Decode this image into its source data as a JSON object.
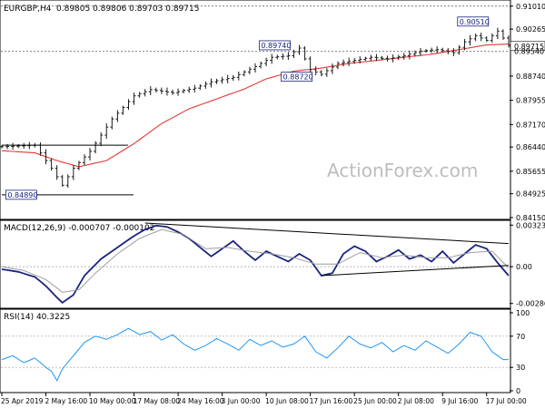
{
  "chart_data": [
    {
      "type": "candlestick",
      "panel": "price",
      "title": "EURGBP,H4",
      "ohlc_header": "0.89805 0.89806 0.89703 0.89715",
      "y_ticks": [
        "0.91010",
        "0.90265",
        "0.89715",
        "0.88740",
        "0.87955",
        "0.87170",
        "0.86440",
        "0.85655",
        "0.84925",
        "0.84150"
      ],
      "ylim": [
        0.8415,
        0.9115
      ],
      "current_price": "0.89715",
      "current_price_box_color": "#ffffff",
      "ref_line_price": "0.89540",
      "top_ref_price": "0.91010",
      "annotations": [
        {
          "label": "0.84890",
          "value": 0.8489
        },
        {
          "label": "0.89740",
          "value": 0.8974
        },
        {
          "label": "0.88720",
          "value": 0.8872
        },
        {
          "label": "0.90510",
          "value": 0.9051
        }
      ],
      "watermark": "ActionForex.com",
      "ma_color": "#e53935",
      "bar_color": "#1a1a1a",
      "close_path": [
        [
          0,
          0.8645
        ],
        [
          6,
          0.865
        ],
        [
          9,
          0.8575
        ],
        [
          11,
          0.852
        ],
        [
          13,
          0.8575
        ],
        [
          16,
          0.863
        ],
        [
          20,
          0.8735
        ],
        [
          24,
          0.881
        ],
        [
          27,
          0.883
        ],
        [
          31,
          0.882
        ],
        [
          35,
          0.8835
        ],
        [
          38,
          0.8855
        ],
        [
          42,
          0.887
        ],
        [
          46,
          0.8905
        ],
        [
          49,
          0.8935
        ],
        [
          52,
          0.894
        ],
        [
          54,
          0.8965
        ],
        [
          56,
          0.8895
        ],
        [
          58,
          0.888
        ],
        [
          61,
          0.8915
        ],
        [
          64,
          0.8925
        ],
        [
          67,
          0.8935
        ],
        [
          70,
          0.893
        ],
        [
          73,
          0.894
        ],
        [
          76,
          0.8955
        ],
        [
          79,
          0.896
        ],
        [
          82,
          0.895
        ],
        [
          84,
          0.8985
        ],
        [
          86,
          0.9005
        ],
        [
          88,
          0.899
        ],
        [
          90,
          0.902
        ],
        [
          92,
          0.8975
        ]
      ],
      "ma_path": [
        [
          0,
          0.8632
        ],
        [
          6,
          0.8625
        ],
        [
          10,
          0.86
        ],
        [
          14,
          0.858
        ],
        [
          19,
          0.86
        ],
        [
          24,
          0.8655
        ],
        [
          29,
          0.872
        ],
        [
          34,
          0.8768
        ],
        [
          39,
          0.88
        ],
        [
          44,
          0.8832
        ],
        [
          48,
          0.8865
        ],
        [
          53,
          0.889
        ],
        [
          58,
          0.89
        ],
        [
          63,
          0.8915
        ],
        [
          68,
          0.8925
        ],
        [
          73,
          0.8935
        ],
        [
          78,
          0.8945
        ],
        [
          83,
          0.896
        ],
        [
          88,
          0.8975
        ],
        [
          92,
          0.8978
        ]
      ],
      "trendlines": [
        {
          "from": [
            0,
            0.865
          ],
          "to": [
            13,
            0.865
          ]
        },
        {
          "from": [
            0,
            0.8489
          ],
          "to": [
            14,
            0.8489
          ]
        }
      ],
      "x_count": 93
    },
    {
      "type": "line",
      "panel": "macd",
      "title": "MACD(12,26,9) -0.000707 -0.000102",
      "y_ticks": [
        "0.003239",
        "0.00",
        "-0.002868"
      ],
      "ylim": [
        -0.0031,
        0.0034
      ],
      "series": [
        {
          "color": "#1a237e",
          "values": [
            [
              0,
              -0.0002
            ],
            [
              3,
              -0.0004
            ],
            [
              6,
              -0.0008
            ],
            [
              8,
              -0.0015
            ],
            [
              10,
              -0.0024
            ],
            [
              11,
              -0.0028
            ],
            [
              13,
              -0.0022
            ],
            [
              15,
              -0.0007
            ],
            [
              18,
              0.0006
            ],
            [
              21,
              0.0015
            ],
            [
              24,
              0.0024
            ],
            [
              26,
              0.0029
            ],
            [
              28,
              0.0032
            ],
            [
              30,
              0.0031
            ],
            [
              32,
              0.0027
            ],
            [
              34,
              0.0022
            ],
            [
              36,
              0.0015
            ],
            [
              38,
              0.0008
            ],
            [
              40,
              0.0014
            ],
            [
              42,
              0.002
            ],
            [
              44,
              0.0012
            ],
            [
              46,
              0.0005
            ],
            [
              48,
              0.0012
            ],
            [
              50,
              0.0008
            ],
            [
              52,
              0.0004
            ],
            [
              54,
              0.001
            ],
            [
              56,
              0.0005
            ],
            [
              58,
              -0.0007
            ],
            [
              60,
              -0.0005
            ],
            [
              62,
              0.001
            ],
            [
              64,
              0.0016
            ],
            [
              66,
              0.0012
            ],
            [
              68,
              0.0004
            ],
            [
              70,
              0.0008
            ],
            [
              72,
              0.0013
            ],
            [
              74,
              0.0006
            ],
            [
              76,
              0.0009
            ],
            [
              78,
              0.0004
            ],
            [
              80,
              0.0012
            ],
            [
              82,
              0.0003
            ],
            [
              84,
              0.001
            ],
            [
              86,
              0.0017
            ],
            [
              88,
              0.0014
            ],
            [
              90,
              0.0003
            ],
            [
              92,
              -0.0007
            ]
          ]
        },
        {
          "color": "#9e9e9e",
          "values": [
            [
              0,
              0.0
            ],
            [
              4,
              -0.0003
            ],
            [
              8,
              -0.001
            ],
            [
              11,
              -0.002
            ],
            [
              14,
              -0.0018
            ],
            [
              17,
              -0.0005
            ],
            [
              21,
              0.001
            ],
            [
              25,
              0.0022
            ],
            [
              29,
              0.0029
            ],
            [
              33,
              0.0025
            ],
            [
              37,
              0.0014
            ],
            [
              41,
              0.0015
            ],
            [
              45,
              0.0012
            ],
            [
              49,
              0.001
            ],
            [
              53,
              0.0007
            ],
            [
              57,
              0.0002
            ],
            [
              61,
              0.0002
            ],
            [
              65,
              0.0011
            ],
            [
              69,
              0.0007
            ],
            [
              73,
              0.0009
            ],
            [
              77,
              0.0007
            ],
            [
              81,
              0.0007
            ],
            [
              85,
              0.0011
            ],
            [
              89,
              0.0012
            ],
            [
              92,
              -0.0001
            ]
          ]
        }
      ],
      "trendlines": [
        {
          "from": [
            26,
            0.0034
          ],
          "to": [
            92,
            0.0018
          ]
        },
        {
          "from": [
            58,
            -0.0007
          ],
          "to": [
            92,
            0.0001
          ]
        }
      ],
      "x_count": 93
    },
    {
      "type": "line",
      "panel": "rsi",
      "title": "RSI(14) 40.3225",
      "y_ticks": [
        "100",
        "70",
        "30",
        "0"
      ],
      "ylim": [
        0,
        100
      ],
      "levels": [
        70,
        30
      ],
      "series": [
        {
          "color": "#2196f3",
          "values": [
            [
              0,
              40
            ],
            [
              2,
              45
            ],
            [
              4,
              36
            ],
            [
              6,
              42
            ],
            [
              8,
              30
            ],
            [
              9,
              25
            ],
            [
              10,
              13
            ],
            [
              11,
              28
            ],
            [
              13,
              45
            ],
            [
              15,
              62
            ],
            [
              17,
              70
            ],
            [
              19,
              66
            ],
            [
              21,
              72
            ],
            [
              23,
              80
            ],
            [
              25,
              72
            ],
            [
              27,
              76
            ],
            [
              29,
              65
            ],
            [
              31,
              72
            ],
            [
              33,
              60
            ],
            [
              35,
              52
            ],
            [
              37,
              58
            ],
            [
              39,
              67
            ],
            [
              41,
              60
            ],
            [
              43,
              52
            ],
            [
              45,
              66
            ],
            [
              47,
              58
            ],
            [
              49,
              64
            ],
            [
              51,
              56
            ],
            [
              53,
              60
            ],
            [
              55,
              70
            ],
            [
              57,
              50
            ],
            [
              59,
              42
            ],
            [
              61,
              55
            ],
            [
              63,
              70
            ],
            [
              65,
              60
            ],
            [
              67,
              55
            ],
            [
              69,
              62
            ],
            [
              71,
              50
            ],
            [
              73,
              58
            ],
            [
              75,
              52
            ],
            [
              77,
              64
            ],
            [
              79,
              56
            ],
            [
              81,
              48
            ],
            [
              83,
              60
            ],
            [
              85,
              75
            ],
            [
              87,
              70
            ],
            [
              89,
              50
            ],
            [
              91,
              40
            ],
            [
              92,
              40
            ]
          ]
        }
      ],
      "x_count": 93
    }
  ],
  "x_axis": {
    "labels": [
      "25 Apr 2019",
      "2 May 16:00",
      "10 May 00:00",
      "17 May 08:00",
      "24 May 16:00",
      "3 Jun 00:00",
      "10 Jun 08:00",
      "17 Jun 16:00",
      "25 Jun 00:00",
      "2 Jul 08:00",
      "9 Jul 16:00",
      "17 Jul 00:00"
    ],
    "label_index": [
      0,
      8,
      16,
      24,
      32,
      40,
      48,
      56,
      64,
      72,
      80,
      88
    ]
  }
}
